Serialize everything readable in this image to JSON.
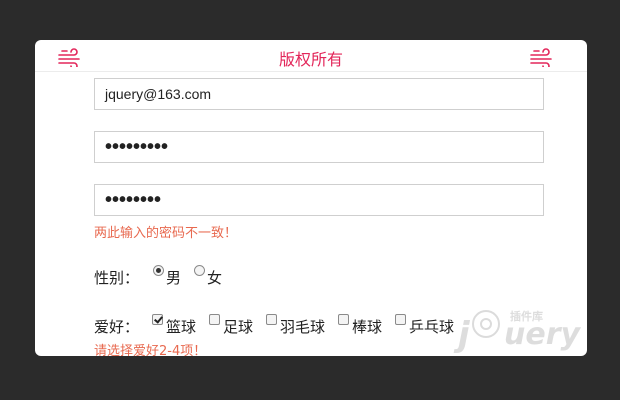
{
  "header": {
    "title": "版权所有"
  },
  "form": {
    "email_value": "jquery@163.com",
    "password_value": "•••••••••",
    "confirm_password_value": "••••••••",
    "password_error": "两此输入的密码不一致！",
    "gender": {
      "label": "性别：",
      "options": [
        {
          "label": "男",
          "checked": true
        },
        {
          "label": "女",
          "checked": false
        }
      ]
    },
    "hobby": {
      "label": "爱好：",
      "options": [
        {
          "label": "篮球",
          "checked": true
        },
        {
          "label": "足球",
          "checked": false
        },
        {
          "label": "羽毛球",
          "checked": false
        },
        {
          "label": "棒球",
          "checked": false
        },
        {
          "label": "乒乓球",
          "checked": false
        }
      ],
      "error": "请选择爱好2-4项！"
    }
  },
  "watermark": {
    "text": "jQuery",
    "subtext": "插件库"
  },
  "colors": {
    "background": "#2b2b2b",
    "card": "#ffffff",
    "accent": "#e3265a",
    "error": "#e8694f",
    "border": "#cfcfcf"
  },
  "icons": {
    "header_left": "wind-icon",
    "header_right": "wind-icon"
  }
}
